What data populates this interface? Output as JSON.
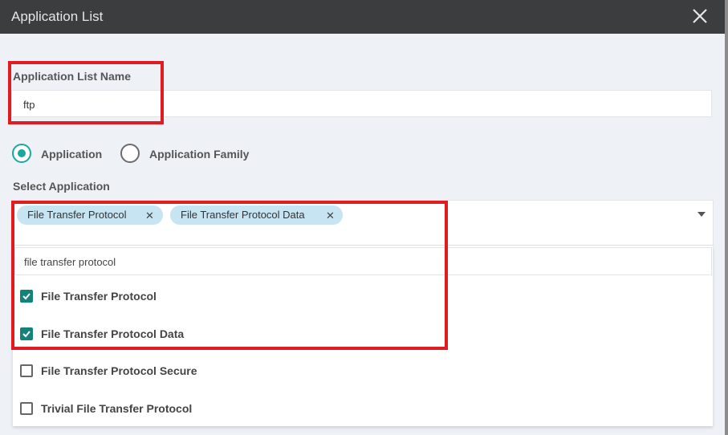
{
  "dialog": {
    "title": "Application List",
    "close_icon": "close-icon"
  },
  "form": {
    "name_label": "Application List Name",
    "name_value": "ftp",
    "radio_options": [
      {
        "label": "Application",
        "selected": true
      },
      {
        "label": "Application Family",
        "selected": false
      }
    ],
    "select_label": "Select Application",
    "selected_chips": [
      {
        "label": "File Transfer Protocol",
        "remove_icon": "close-icon"
      },
      {
        "label": "File Transfer Protocol Data",
        "remove_icon": "close-icon"
      }
    ],
    "dropdown_icon": "caret-down-icon",
    "search_value": "file transfer protocol",
    "options": [
      {
        "label": "File Transfer Protocol",
        "checked": true
      },
      {
        "label": "File Transfer Protocol Data",
        "checked": true
      },
      {
        "label": "File Transfer Protocol Secure",
        "checked": false
      },
      {
        "label": "Trivial File Transfer Protocol",
        "checked": false
      }
    ]
  },
  "colors": {
    "accent": "#1aa89c",
    "checkbox": "#14827b",
    "chip": "#c7e4f2",
    "highlight": "#e11b22",
    "titlebar": "#3b3d3f"
  }
}
